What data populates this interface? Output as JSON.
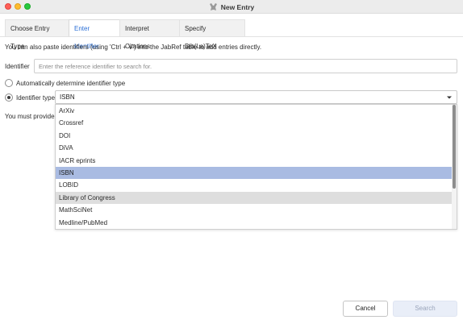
{
  "window": {
    "title": "New Entry",
    "app_icon": "jabref-icon"
  },
  "tabs": [
    {
      "label": "Choose Entry Type",
      "active": false
    },
    {
      "label": "Enter Identifier",
      "active": true
    },
    {
      "label": "Interpret Citations",
      "active": false
    },
    {
      "label": "Specify Bib(La)TeX",
      "active": false
    }
  ],
  "info_text": "You can also paste identifiers (using 'Ctrl + V') into the JabRef table to add entries directly.",
  "identifier": {
    "label": "Identifier",
    "placeholder": "Enter the reference identifier to search for.",
    "value": ""
  },
  "radio_auto": {
    "label": "Automatically determine identifier type",
    "checked": false
  },
  "radio_type": {
    "label": "Identifier type",
    "checked": true
  },
  "select": {
    "value": "ISBN",
    "caret_icon": "chevron-down-icon"
  },
  "must_text": "You must provide a",
  "dropdown": {
    "options": [
      {
        "label": "ArXiv",
        "state": "normal"
      },
      {
        "label": "Crossref",
        "state": "normal"
      },
      {
        "label": "DOI",
        "state": "normal"
      },
      {
        "label": "DiVA",
        "state": "normal"
      },
      {
        "label": "IACR eprints",
        "state": "normal"
      },
      {
        "label": "ISBN",
        "state": "selected"
      },
      {
        "label": "LOBID",
        "state": "normal"
      },
      {
        "label": "Library of Congress",
        "state": "hovered"
      },
      {
        "label": "MathSciNet",
        "state": "normal"
      },
      {
        "label": "Medline/PubMed",
        "state": "normal"
      }
    ]
  },
  "buttons": {
    "cancel": "Cancel",
    "search": "Search"
  },
  "colors": {
    "accent_tab": "#2b6fd6",
    "selected_option": "#a9bbe2",
    "hovered_option": "#dedede",
    "disabled_button_bg": "#e9eef8"
  }
}
